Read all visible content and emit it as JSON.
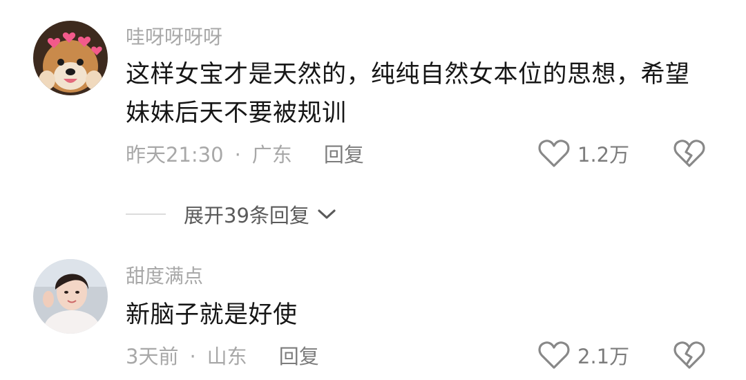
{
  "comments": [
    {
      "username": "哇呀呀呀呀",
      "text": "这样女宝才是天然的，纯纯自然女本位的思想，希望妹妹后天不要被规训",
      "time": "昨天21:30",
      "separator": "·",
      "location": "广东",
      "reply_label": "回复",
      "like_count": "1.2万"
    },
    {
      "username": "甜度满点",
      "text": "新脑子就是好使",
      "time": "3天前",
      "separator": "·",
      "location": "山东",
      "reply_label": "回复",
      "like_count": "2.1万"
    }
  ],
  "expand_replies": {
    "label": "展开39条回复"
  },
  "icons": {
    "like": "heart-outline-icon",
    "dislike": "broken-heart-icon",
    "expand": "chevron-down-icon"
  },
  "colors": {
    "username": "#a8a8a8",
    "text": "#161616",
    "meta": "#a8a8a8",
    "reply": "#7c7c7c",
    "icon": "#888888"
  }
}
